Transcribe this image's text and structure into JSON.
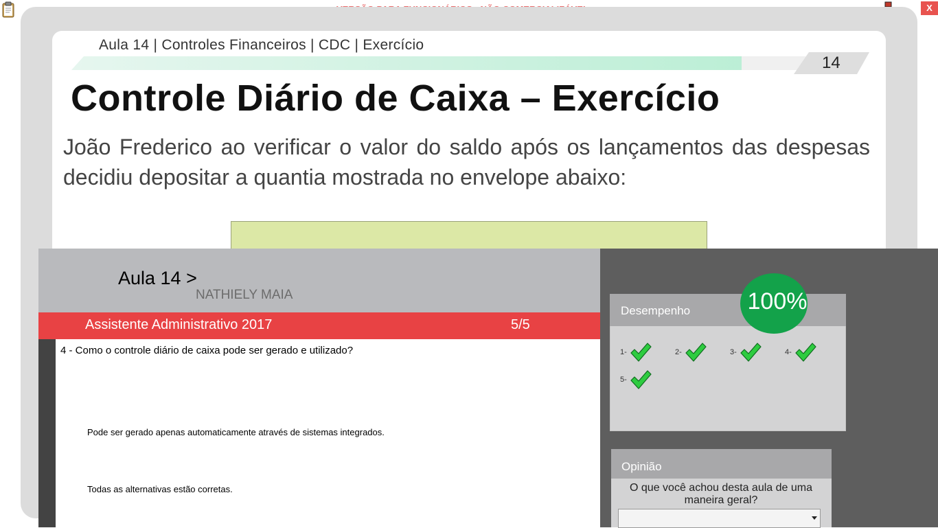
{
  "window": {
    "banner": "VERSÃO PARA FUNCIONÁRIOS - NÃO COMERCIALIZÁVEL",
    "close_label": "X",
    "icons": [
      "clipboard-icon",
      "network-icon"
    ]
  },
  "slide": {
    "breadcrumb": "Aula 14 | Controles Financeiros | CDC | Exercício",
    "number": "14",
    "title": "Controle Diário de Caixa – Exercício",
    "text": "João Frederico ao verificar o valor do saldo após os lançamentos das despesas decidiu depositar a quantia mostrada no envelope abaixo:",
    "envelope_color": "#dce8a6"
  },
  "quiz": {
    "aula": "Aula 14 >",
    "student": "NATHIELY MAIA",
    "course": "Assistente Administrativo 2017",
    "count": "5/5",
    "question": "4 - Como o controle diário de caixa pode ser gerado e utilizado?",
    "options": [
      "Pode ser gerado apenas automaticamente através de sistemas integrados.",
      "Todas as alternativas estão corretas."
    ]
  },
  "performance": {
    "title": "Desempenho",
    "percent": "100%",
    "items": [
      {
        "label": "1-",
        "status": "correct"
      },
      {
        "label": "2-",
        "status": "correct"
      },
      {
        "label": "3-",
        "status": "correct"
      },
      {
        "label": "4-",
        "status": "correct"
      },
      {
        "label": "5-",
        "status": "correct"
      }
    ]
  },
  "opinion": {
    "title": "Opinião",
    "question": "O que você achou desta aula de uma maneira geral?",
    "selected": ""
  },
  "colors": {
    "accent_red": "#e84244",
    "success_green": "#13a24a",
    "dark_panel": "#5e5e5e"
  }
}
